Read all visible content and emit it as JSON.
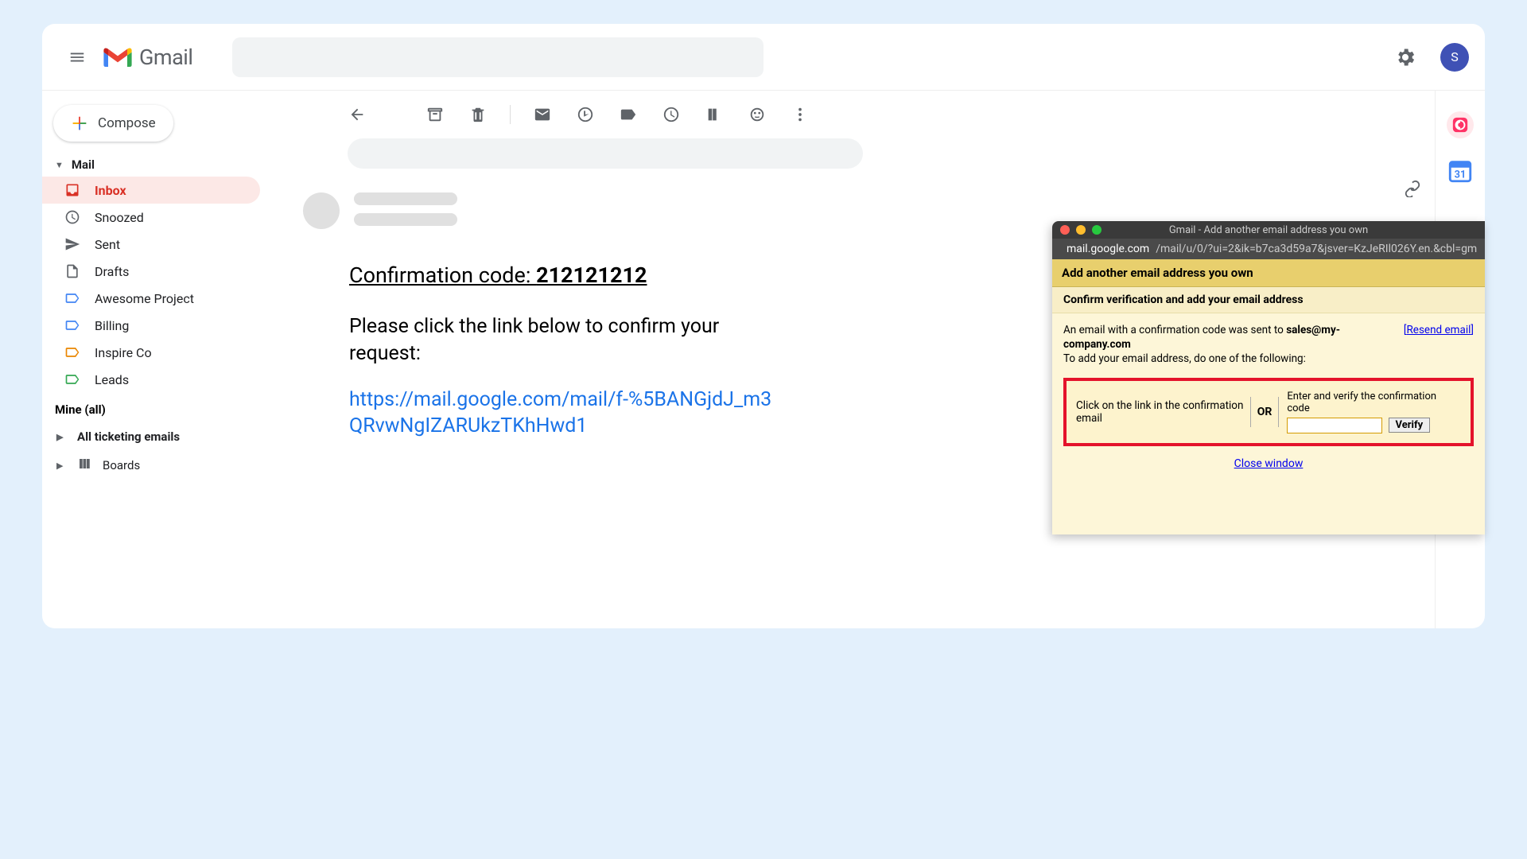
{
  "header": {
    "product": "Gmail",
    "avatar_letter": "S"
  },
  "sidebar": {
    "compose": "Compose",
    "mail_label": "Mail",
    "items": [
      {
        "label": "Inbox"
      },
      {
        "label": "Snoozed"
      },
      {
        "label": "Sent"
      },
      {
        "label": "Drafts"
      },
      {
        "label": "Awesome Project"
      },
      {
        "label": "Billing"
      },
      {
        "label": "Inspire Co"
      },
      {
        "label": "Leads"
      }
    ],
    "mine_label": "Mine (all)",
    "ticketing": "All ticketing emails",
    "boards": "Boards"
  },
  "email": {
    "conf_prefix": "Confirmation code: ",
    "conf_code": "212121212",
    "body": "Please click the link below to confirm your request:",
    "link": "https://mail.google.com/mail/f-%5BANGjdJ_m3QRvwNgIZARUkzTKhHwd1"
  },
  "popup": {
    "window_title": "Gmail - Add another email address you own",
    "url_domain": "mail.google.com",
    "url_path": "/mail/u/0/?ui=2&ik=b7ca3d59a7&jsver=KzJeRIl026Y.en.&cbl=gm",
    "heading": "Add another email address you own",
    "subheading": "Confirm verification and add your email address",
    "sent_prefix": "An email with a confirmation code was sent to ",
    "sent_email": "sales@my-company.com",
    "instruction": "To add your email address, do one of the following:",
    "resend": "Resend email",
    "option_left": "Click on the link in the confirmation email",
    "or": "OR",
    "option_right": "Enter and verify the confirmation code",
    "verify": "Verify",
    "close": "Close window"
  }
}
